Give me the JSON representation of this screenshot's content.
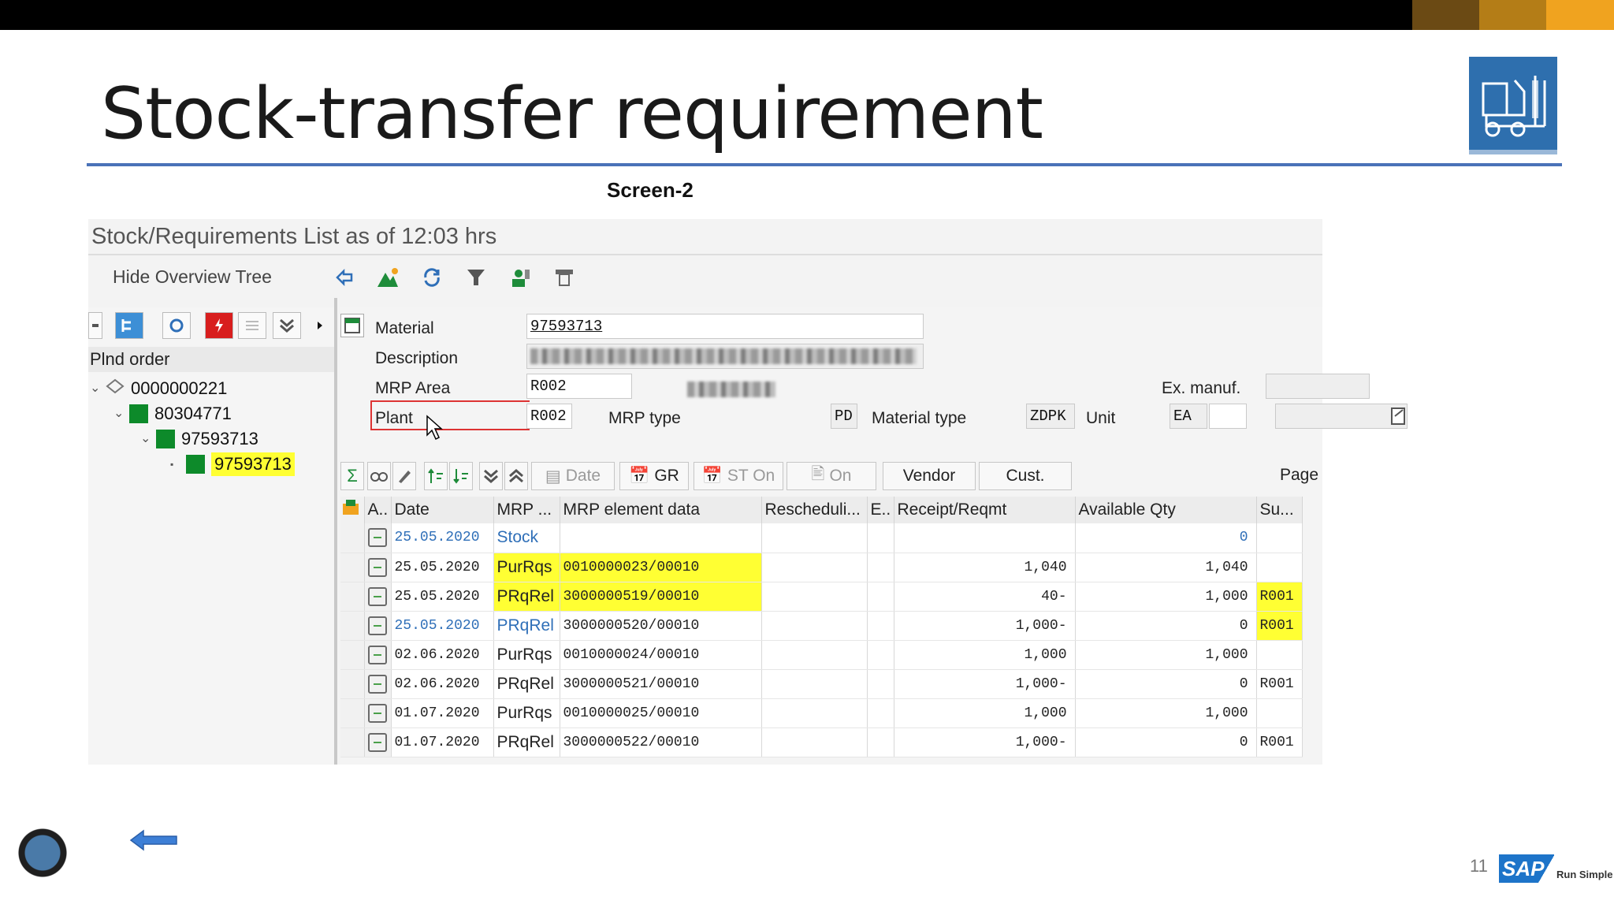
{
  "slide": {
    "title": "Stock-transfer requirement",
    "screen_label": "Screen-2",
    "page_number": "11",
    "brand": {
      "logo": "SAP",
      "tagline": "Run Simple"
    },
    "accent_colors": {
      "rule": "#4a72b8",
      "highlight": "#ffff33",
      "tree_node": "#0d8a2a",
      "link_blue": "#2f6fb8"
    }
  },
  "sap": {
    "header_title": "Stock/Requirements List as of 12:03 hrs",
    "hide_tree_label": "Hide Overview Tree",
    "tree": {
      "column_header": "Plnd order",
      "nodes": [
        {
          "label": "0000000221"
        },
        {
          "label": "80304771"
        },
        {
          "label": "97593713"
        },
        {
          "label": "97593713"
        }
      ]
    },
    "header_fields": {
      "material_label": "Material",
      "material_value": "97593713",
      "description_label": "Description",
      "mrp_area_label": "MRP Area",
      "mrp_area_value": "R002",
      "ex_manuf_label": "Ex. manuf.",
      "plant_label": "Plant",
      "plant_value": "R002",
      "mrp_type_label": "MRP type",
      "mrp_type_value": "PD",
      "material_type_label": "Material type",
      "material_type_value": "ZDPK",
      "unit_label": "Unit",
      "unit_value": "EA"
    },
    "toolbar": {
      "sum_icon": "Σ",
      "date_label": "Date",
      "gr_label": "GR",
      "st_on_label": "ST On",
      "on_label": "On",
      "vendor_label": "Vendor",
      "cust_label": "Cust.",
      "page_label": "Page"
    },
    "table": {
      "columns": [
        "A..",
        "Date",
        "MRP ...",
        "MRP element data",
        "Rescheduli...",
        "E..",
        "Receipt/Reqmt",
        "Available Qty",
        "Su..."
      ],
      "rows": [
        {
          "date": "25.05.2020",
          "mrp": "Stock",
          "element": "",
          "resched": "",
          "e": "",
          "receipt": "",
          "available": "0",
          "su": ""
        },
        {
          "date": "25.05.2020",
          "mrp": "PurRqs",
          "element": "0010000023/00010",
          "resched": "",
          "e": "",
          "receipt": "1,040",
          "available": "1,040",
          "su": ""
        },
        {
          "date": "25.05.2020",
          "mrp": "PRqRel",
          "element": "3000000519/00010",
          "resched": "",
          "e": "",
          "receipt": "40-",
          "available": "1,000",
          "su": "R001"
        },
        {
          "date": "25.05.2020",
          "mrp": "PRqRel",
          "element": "3000000520/00010",
          "resched": "",
          "e": "",
          "receipt": "1,000-",
          "available": "0",
          "su": "R001"
        },
        {
          "date": "02.06.2020",
          "mrp": "PurRqs",
          "element": "0010000024/00010",
          "resched": "",
          "e": "",
          "receipt": "1,000",
          "available": "1,000",
          "su": ""
        },
        {
          "date": "02.06.2020",
          "mrp": "PRqRel",
          "element": "3000000521/00010",
          "resched": "",
          "e": "",
          "receipt": "1,000-",
          "available": "0",
          "su": "R001"
        },
        {
          "date": "01.07.2020",
          "mrp": "PurRqs",
          "element": "0010000025/00010",
          "resched": "",
          "e": "",
          "receipt": "1,000",
          "available": "1,000",
          "su": ""
        },
        {
          "date": "01.07.2020",
          "mrp": "PRqRel",
          "element": "3000000522/00010",
          "resched": "",
          "e": "",
          "receipt": "1,000-",
          "available": "0",
          "su": "R001"
        }
      ]
    }
  }
}
